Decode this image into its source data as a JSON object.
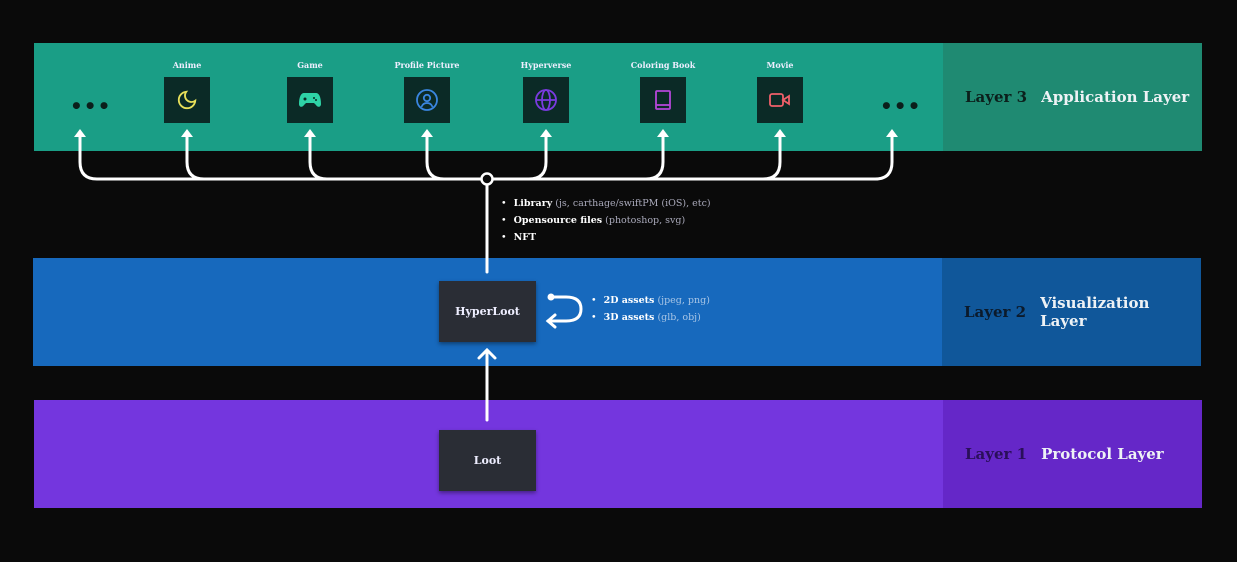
{
  "layers": [
    {
      "number": "Layer 3",
      "name": "Application Layer",
      "color": "#1a9e86"
    },
    {
      "number": "Layer 2",
      "name": "Visualization Layer",
      "color": "#1769bd"
    },
    {
      "number": "Layer 1",
      "name": "Protocol Layer",
      "color": "#7436de"
    }
  ],
  "apps": [
    {
      "label": "Anime",
      "icon": "moon-icon",
      "color": "#e8e05a"
    },
    {
      "label": "Game",
      "icon": "gamepad-icon",
      "color": "#2ed3a6"
    },
    {
      "label": "Profile Picture",
      "icon": "user-circle-icon",
      "color": "#3a86e0"
    },
    {
      "label": "Hyperverse",
      "icon": "globe-icon",
      "color": "#7a3be0"
    },
    {
      "label": "Coloring Book",
      "icon": "book-icon",
      "color": "#b446d8"
    },
    {
      "label": "Movie",
      "icon": "video-camera-icon",
      "color": "#f0606a"
    }
  ],
  "more": "•••",
  "distribution": [
    {
      "bold": "Library",
      "detail": "(js, carthage/swiftPM (iOS), etc)"
    },
    {
      "bold": "Opensource files",
      "detail": "(photoshop, svg)"
    },
    {
      "bold": "NFT",
      "detail": ""
    }
  ],
  "hyperloot": {
    "label": "HyperLoot",
    "assets": [
      {
        "bold": "2D assets",
        "detail": "(jpeg, png)"
      },
      {
        "bold": "3D assets",
        "detail": "(glb, obj)"
      }
    ]
  },
  "loot": {
    "label": "Loot"
  }
}
